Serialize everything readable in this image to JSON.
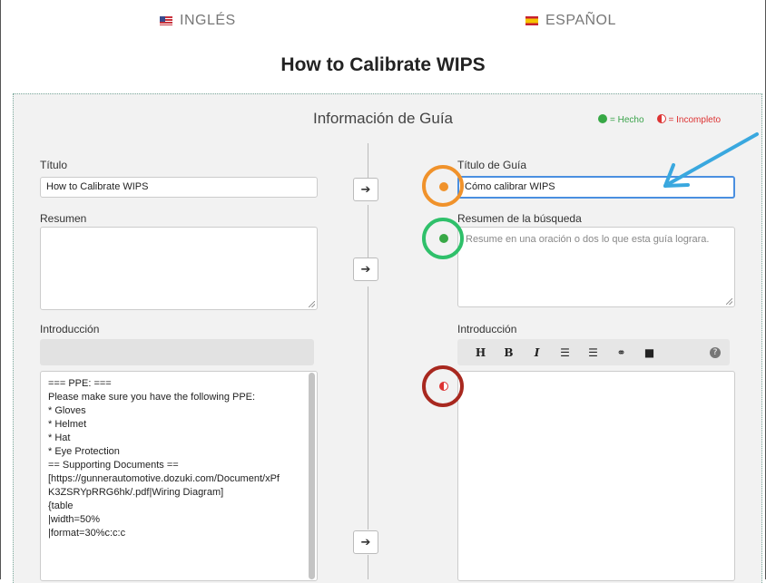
{
  "languages": {
    "source": "INGLÉS",
    "target": "ESPAÑOL"
  },
  "guide_title": "How to Calibrate WIPS",
  "panel": {
    "heading": "Información de Guía",
    "legend": {
      "done": "= Hecho",
      "incomplete": "= Incompleto"
    }
  },
  "left": {
    "title_label": "Título",
    "title_value": "How to Calibrate WIPS",
    "summary_label": "Resumen",
    "intro_label": "Introducción",
    "intro_lines": [
      "=== PPE: ===",
      "Please make sure you have the following PPE:",
      "",
      "* Gloves",
      "* Helmet",
      "* Hat",
      "* Eye Protection",
      "== Supporting Documents ==",
      "[https://gunnerautomotive.dozuki.com/Document/xPf",
      "K3ZSRYpRRG6hk/.pdf|Wiring Diagram]",
      "",
      "{table",
      "|width=50%",
      "|format=30%c:c:c"
    ]
  },
  "right": {
    "title_label": "Título de Guía",
    "title_value": "Cómo calibrar WIPS",
    "summary_label": "Resumen de la búsqueda",
    "summary_placeholder": "Resume en una oración o dos lo que esta guía lograra.",
    "intro_label": "Introducción",
    "toolbar": [
      "H",
      "B",
      "I",
      "☰",
      "☰",
      "⚭",
      "■"
    ],
    "help": "?"
  },
  "copy_arrow": "➔",
  "colors": {
    "annotation_orange": "#f0922b",
    "annotation_green": "#2fc06a",
    "annotation_red": "#a8281f",
    "annotation_blue": "#3aa8df",
    "done_green": "#37a845",
    "incomplete_red": "#dd3333"
  }
}
